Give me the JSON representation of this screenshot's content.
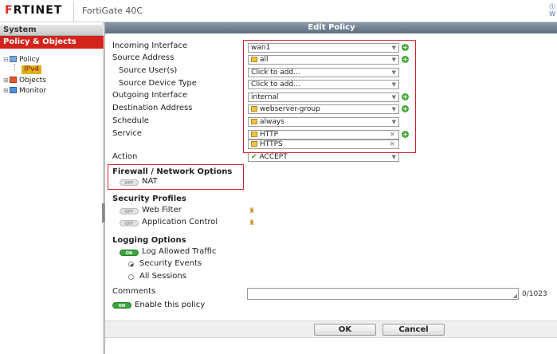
{
  "app": {
    "brand": "F",
    "brand_rest": "RTINET",
    "model": "FortiGate 40C",
    "corner_text": "W"
  },
  "nav": {
    "system_label": "System",
    "policy_objects_label": "Policy & Objects",
    "tree": [
      {
        "label": "Policy",
        "expander": "⊟"
      },
      {
        "label": "IPv4",
        "selected": true
      },
      {
        "label": "Objects",
        "expander": "⊞"
      },
      {
        "label": "Monitor",
        "expander": "⊞"
      }
    ]
  },
  "form": {
    "title": "Edit Policy",
    "incoming_interface": {
      "label": "Incoming Interface",
      "value": "wan1"
    },
    "source_address": {
      "label": "Source Address",
      "value": "all"
    },
    "source_users": {
      "label": "Source User(s)",
      "value": "Click to add..."
    },
    "source_device_type": {
      "label": "Source Device Type",
      "value": "Click to add..."
    },
    "outgoing_interface": {
      "label": "Outgoing Interface",
      "value": "internal"
    },
    "destination_address": {
      "label": "Destination Address",
      "value": "webserver-group"
    },
    "schedule": {
      "label": "Schedule",
      "value": "always"
    },
    "service": {
      "label": "Service",
      "values": [
        "HTTP",
        "HTTPS"
      ]
    },
    "action": {
      "label": "Action",
      "value": "ACCEPT",
      "check": "✔"
    },
    "firewall_section": "Firewall / Network Options",
    "nat": {
      "label": "NAT",
      "state": "OFF"
    },
    "security_profiles_section": "Security Profiles",
    "web_filter": {
      "label": "Web Filter",
      "state": "OFF"
    },
    "application_control": {
      "label": "Application Control",
      "state": "OFF"
    },
    "logging_section": "Logging Options",
    "log_allowed_traffic": {
      "label": "Log Allowed Traffic",
      "state": "ON"
    },
    "security_events_label": "Security Events",
    "all_sessions_label": "All Sessions",
    "comments": {
      "label": "Comments",
      "value": "",
      "counter": "0/1023"
    },
    "enable_policy": {
      "label": "Enable this policy",
      "state": "ON"
    },
    "ok_label": "OK",
    "cancel_label": "Cancel"
  },
  "colors": {
    "brand_red": "#d2241b",
    "highlight_box": "#d3222a",
    "toggle_on": "#39a53a",
    "header_blue_gray": "#6f7e90"
  }
}
